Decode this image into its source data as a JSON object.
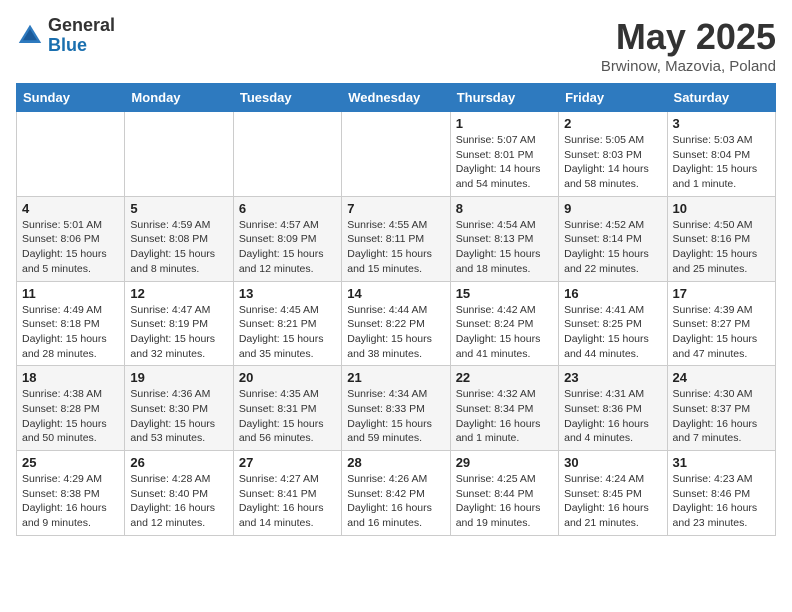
{
  "logo": {
    "general": "General",
    "blue": "Blue"
  },
  "title": "May 2025",
  "subtitle": "Brwinow, Mazovia, Poland",
  "weekdays": [
    "Sunday",
    "Monday",
    "Tuesday",
    "Wednesday",
    "Thursday",
    "Friday",
    "Saturday"
  ],
  "weeks": [
    [
      {
        "day": "",
        "info": ""
      },
      {
        "day": "",
        "info": ""
      },
      {
        "day": "",
        "info": ""
      },
      {
        "day": "",
        "info": ""
      },
      {
        "day": "1",
        "info": "Sunrise: 5:07 AM\nSunset: 8:01 PM\nDaylight: 14 hours\nand 54 minutes."
      },
      {
        "day": "2",
        "info": "Sunrise: 5:05 AM\nSunset: 8:03 PM\nDaylight: 14 hours\nand 58 minutes."
      },
      {
        "day": "3",
        "info": "Sunrise: 5:03 AM\nSunset: 8:04 PM\nDaylight: 15 hours\nand 1 minute."
      }
    ],
    [
      {
        "day": "4",
        "info": "Sunrise: 5:01 AM\nSunset: 8:06 PM\nDaylight: 15 hours\nand 5 minutes."
      },
      {
        "day": "5",
        "info": "Sunrise: 4:59 AM\nSunset: 8:08 PM\nDaylight: 15 hours\nand 8 minutes."
      },
      {
        "day": "6",
        "info": "Sunrise: 4:57 AM\nSunset: 8:09 PM\nDaylight: 15 hours\nand 12 minutes."
      },
      {
        "day": "7",
        "info": "Sunrise: 4:55 AM\nSunset: 8:11 PM\nDaylight: 15 hours\nand 15 minutes."
      },
      {
        "day": "8",
        "info": "Sunrise: 4:54 AM\nSunset: 8:13 PM\nDaylight: 15 hours\nand 18 minutes."
      },
      {
        "day": "9",
        "info": "Sunrise: 4:52 AM\nSunset: 8:14 PM\nDaylight: 15 hours\nand 22 minutes."
      },
      {
        "day": "10",
        "info": "Sunrise: 4:50 AM\nSunset: 8:16 PM\nDaylight: 15 hours\nand 25 minutes."
      }
    ],
    [
      {
        "day": "11",
        "info": "Sunrise: 4:49 AM\nSunset: 8:18 PM\nDaylight: 15 hours\nand 28 minutes."
      },
      {
        "day": "12",
        "info": "Sunrise: 4:47 AM\nSunset: 8:19 PM\nDaylight: 15 hours\nand 32 minutes."
      },
      {
        "day": "13",
        "info": "Sunrise: 4:45 AM\nSunset: 8:21 PM\nDaylight: 15 hours\nand 35 minutes."
      },
      {
        "day": "14",
        "info": "Sunrise: 4:44 AM\nSunset: 8:22 PM\nDaylight: 15 hours\nand 38 minutes."
      },
      {
        "day": "15",
        "info": "Sunrise: 4:42 AM\nSunset: 8:24 PM\nDaylight: 15 hours\nand 41 minutes."
      },
      {
        "day": "16",
        "info": "Sunrise: 4:41 AM\nSunset: 8:25 PM\nDaylight: 15 hours\nand 44 minutes."
      },
      {
        "day": "17",
        "info": "Sunrise: 4:39 AM\nSunset: 8:27 PM\nDaylight: 15 hours\nand 47 minutes."
      }
    ],
    [
      {
        "day": "18",
        "info": "Sunrise: 4:38 AM\nSunset: 8:28 PM\nDaylight: 15 hours\nand 50 minutes."
      },
      {
        "day": "19",
        "info": "Sunrise: 4:36 AM\nSunset: 8:30 PM\nDaylight: 15 hours\nand 53 minutes."
      },
      {
        "day": "20",
        "info": "Sunrise: 4:35 AM\nSunset: 8:31 PM\nDaylight: 15 hours\nand 56 minutes."
      },
      {
        "day": "21",
        "info": "Sunrise: 4:34 AM\nSunset: 8:33 PM\nDaylight: 15 hours\nand 59 minutes."
      },
      {
        "day": "22",
        "info": "Sunrise: 4:32 AM\nSunset: 8:34 PM\nDaylight: 16 hours\nand 1 minute."
      },
      {
        "day": "23",
        "info": "Sunrise: 4:31 AM\nSunset: 8:36 PM\nDaylight: 16 hours\nand 4 minutes."
      },
      {
        "day": "24",
        "info": "Sunrise: 4:30 AM\nSunset: 8:37 PM\nDaylight: 16 hours\nand 7 minutes."
      }
    ],
    [
      {
        "day": "25",
        "info": "Sunrise: 4:29 AM\nSunset: 8:38 PM\nDaylight: 16 hours\nand 9 minutes."
      },
      {
        "day": "26",
        "info": "Sunrise: 4:28 AM\nSunset: 8:40 PM\nDaylight: 16 hours\nand 12 minutes."
      },
      {
        "day": "27",
        "info": "Sunrise: 4:27 AM\nSunset: 8:41 PM\nDaylight: 16 hours\nand 14 minutes."
      },
      {
        "day": "28",
        "info": "Sunrise: 4:26 AM\nSunset: 8:42 PM\nDaylight: 16 hours\nand 16 minutes."
      },
      {
        "day": "29",
        "info": "Sunrise: 4:25 AM\nSunset: 8:44 PM\nDaylight: 16 hours\nand 19 minutes."
      },
      {
        "day": "30",
        "info": "Sunrise: 4:24 AM\nSunset: 8:45 PM\nDaylight: 16 hours\nand 21 minutes."
      },
      {
        "day": "31",
        "info": "Sunrise: 4:23 AM\nSunset: 8:46 PM\nDaylight: 16 hours\nand 23 minutes."
      }
    ]
  ]
}
